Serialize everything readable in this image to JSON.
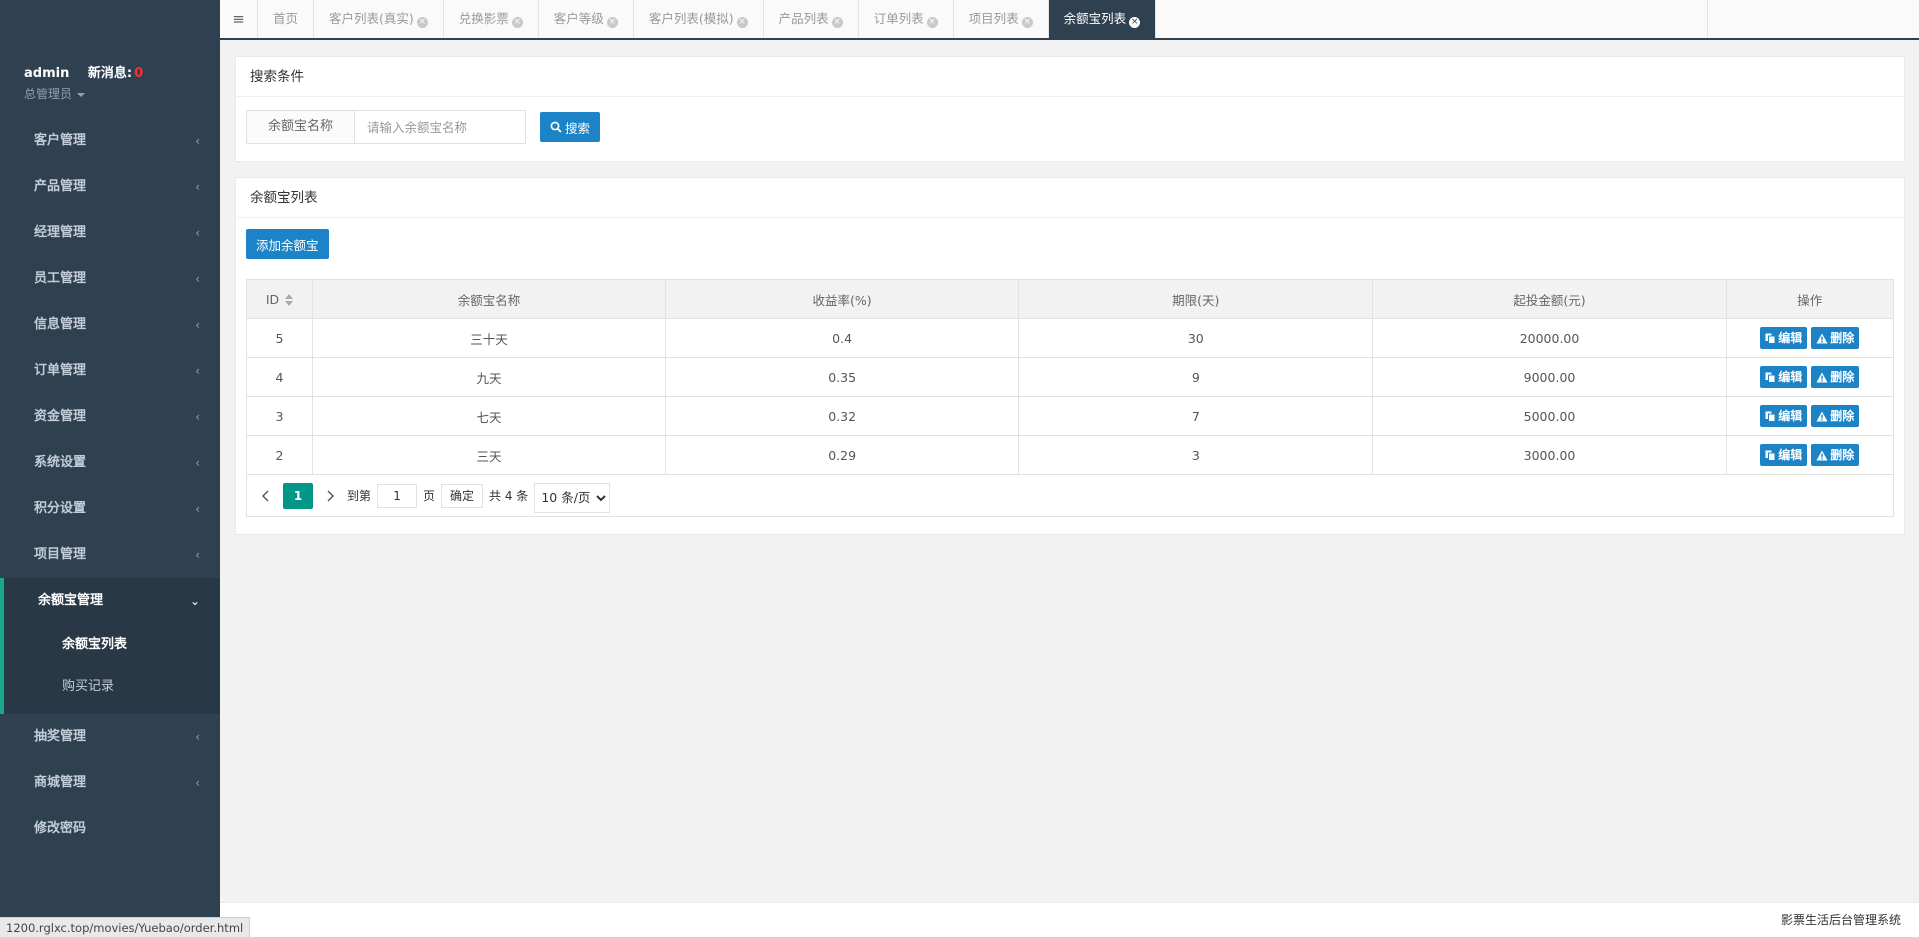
{
  "profile": {
    "username": "admin",
    "messages_label": "新消息:",
    "messages_count": "0",
    "role": "总管理员"
  },
  "sidebar": {
    "items_top": [
      {
        "label": "客户管理"
      },
      {
        "label": "产品管理"
      },
      {
        "label": "经理管理"
      },
      {
        "label": "员工管理"
      },
      {
        "label": "信息管理"
      },
      {
        "label": "订单管理"
      },
      {
        "label": "资金管理"
      },
      {
        "label": "系统设置"
      },
      {
        "label": "积分设置"
      },
      {
        "label": "项目管理"
      }
    ],
    "open_item": {
      "label": "余额宝管理"
    },
    "submenu": [
      {
        "label": "余额宝列表"
      },
      {
        "label": "购买记录"
      }
    ],
    "items_bottom": [
      {
        "label": "抽奖管理"
      },
      {
        "label": "商城管理"
      },
      {
        "label": "修改密码"
      }
    ]
  },
  "tabs": [
    {
      "label": "首页"
    },
    {
      "label": "客户列表(真实)"
    },
    {
      "label": "兑换影票"
    },
    {
      "label": "客户等级"
    },
    {
      "label": "客户列表(模拟)"
    },
    {
      "label": "产品列表"
    },
    {
      "label": "订单列表"
    },
    {
      "label": "项目列表"
    },
    {
      "label": "余额宝列表"
    }
  ],
  "search": {
    "title": "搜索条件",
    "field_label": "余额宝名称",
    "placeholder": "请输入余额宝名称",
    "button": "搜索"
  },
  "list": {
    "title": "余额宝列表",
    "add_button": "添加余额宝",
    "columns": [
      "ID",
      "余额宝名称",
      "收益率(%)",
      "期限(天)",
      "起投金额(元)",
      "操作"
    ],
    "rows": [
      {
        "id": "5",
        "name": "三十天",
        "rate": "0.4",
        "days": "30",
        "min": "20000.00"
      },
      {
        "id": "4",
        "name": "九天",
        "rate": "0.35",
        "days": "9",
        "min": "9000.00"
      },
      {
        "id": "3",
        "name": "七天",
        "rate": "0.32",
        "days": "7",
        "min": "5000.00"
      },
      {
        "id": "2",
        "name": "三天",
        "rate": "0.29",
        "days": "3",
        "min": "3000.00"
      }
    ],
    "edit_label": "编辑",
    "delete_label": "删除"
  },
  "pager": {
    "current": "1",
    "goto_label": "到第",
    "page_value": "1",
    "page_unit": "页",
    "confirm": "确定",
    "total": "共 4 条",
    "page_size": "10 条/页"
  },
  "footer": {
    "text": "影票生活后台管理系统"
  },
  "status_url": "1200.rglxc.top/movies/Yuebao/order.html",
  "colors": {
    "sidebar_bg": "#2f4050",
    "active_tab_bg": "#2f4050",
    "primary_button": "#1c84c6",
    "current_page": "#009688",
    "sidebar_accent": "#19aa8d",
    "message_count": "#ff2d2d"
  }
}
